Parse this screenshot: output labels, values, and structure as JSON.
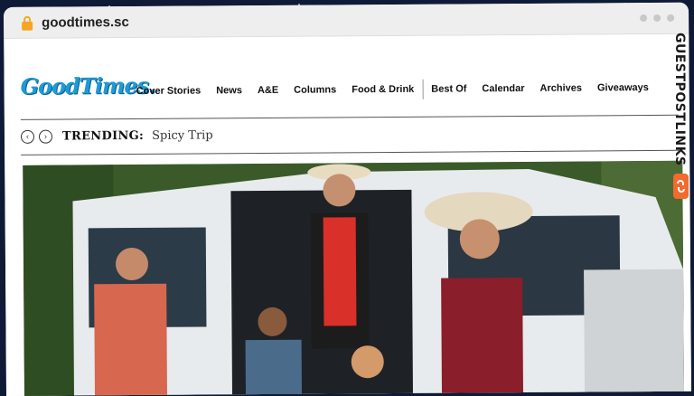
{
  "browser": {
    "url": "goodtimes.sc"
  },
  "site": {
    "logo_text": "GoodTimes.",
    "brand_color": "#1e9ad6"
  },
  "nav": {
    "items": [
      "Cover Stories",
      "News",
      "A&E",
      "Columns",
      "Food & Drink",
      "Best Of",
      "Calendar",
      "Archives",
      "Giveaways"
    ]
  },
  "trending": {
    "label": "TRENDING:",
    "text": "Spicy Trip"
  },
  "hero": {
    "image_alt": ""
  },
  "side_brand": {
    "text": "GUESTPOSTLINKS",
    "accent": "#f26a2e"
  },
  "icons": {
    "lock": "lock-icon",
    "prev": "chevron-left-icon",
    "next": "chevron-right-icon"
  }
}
